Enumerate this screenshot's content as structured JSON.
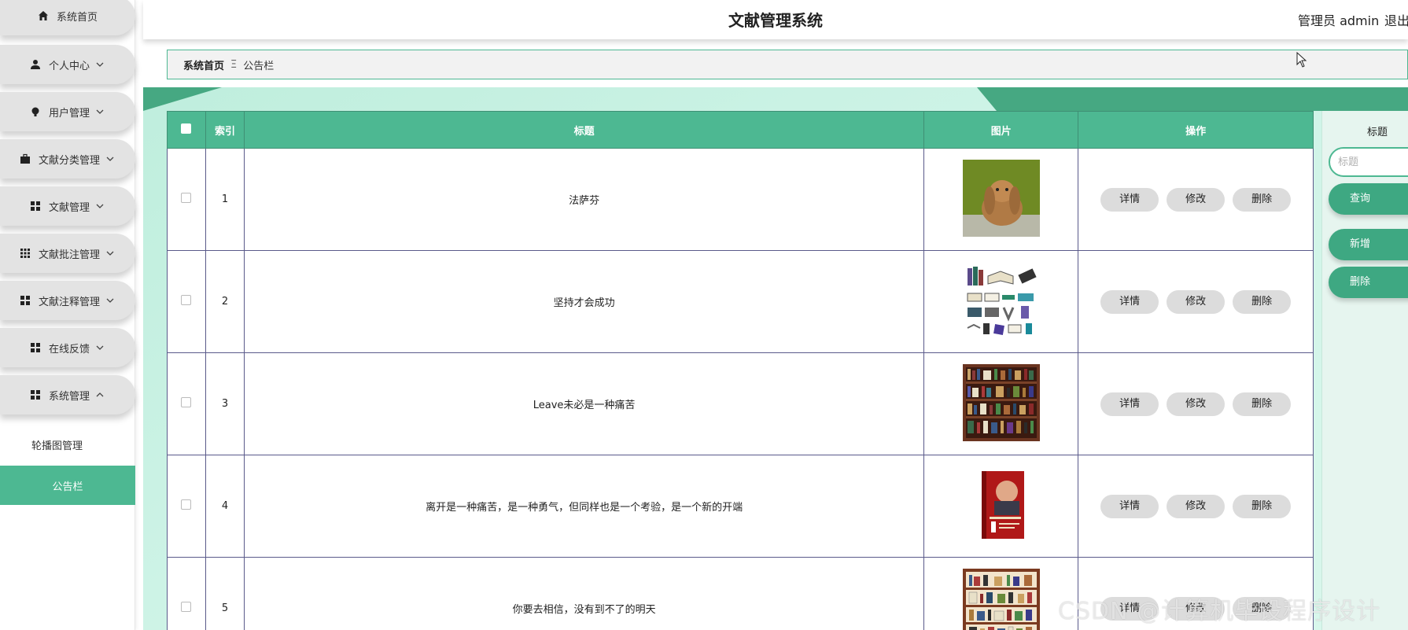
{
  "sidebar": {
    "items": [
      {
        "label": "系统首页",
        "icon": "home-icon",
        "chevron": ""
      },
      {
        "label": "个人中心",
        "icon": "user-icon",
        "chevron": "down"
      },
      {
        "label": "用户管理",
        "icon": "bulb-icon",
        "chevron": "down"
      },
      {
        "label": "文献分类管理",
        "icon": "briefcase-icon",
        "chevron": "down"
      },
      {
        "label": "文献管理",
        "icon": "grid-icon",
        "chevron": "down"
      },
      {
        "label": "文献批注管理",
        "icon": "grid9-icon",
        "chevron": "down"
      },
      {
        "label": "文献注释管理",
        "icon": "grid-icon",
        "chevron": "down"
      },
      {
        "label": "在线反馈",
        "icon": "grid-icon",
        "chevron": "down"
      },
      {
        "label": "系统管理",
        "icon": "grid-icon",
        "chevron": "up"
      }
    ],
    "sub_items": [
      {
        "label": "轮播图管理",
        "active": false
      },
      {
        "label": "公告栏",
        "active": true
      }
    ]
  },
  "header": {
    "title": "文献管理系统",
    "user": "管理员 admin",
    "logout": "退出"
  },
  "breadcrumb": {
    "home": "系统首页",
    "separator": "Ξ",
    "current": "公告栏"
  },
  "table": {
    "columns": [
      "索引",
      "标题",
      "图片",
      "操作"
    ],
    "actions": {
      "detail": "详情",
      "edit": "修改",
      "delete": "删除"
    },
    "rows": [
      {
        "index": "1",
        "title": "法萨芬",
        "image": "rabbit"
      },
      {
        "index": "2",
        "title": "坚持才会成功",
        "image": "books"
      },
      {
        "index": "3",
        "title": "Leave未必是一种痛苦",
        "image": "bookshelf"
      },
      {
        "index": "4",
        "title": "离开是一种痛苦，是一种勇气，但同样也是一个考验，是一个新的开端",
        "image": "book-cover"
      },
      {
        "index": "5",
        "title": "你要去相信，没有到不了的明天",
        "image": "bookshelf"
      }
    ]
  },
  "search_panel": {
    "label": "标题",
    "placeholder": "标题",
    "query": "查询",
    "add": "新增",
    "delete": "删除"
  },
  "watermark": "CSDN @计算机毕设程序设计",
  "colors": {
    "accent": "#4db892",
    "accent_dark": "#3ea882"
  }
}
